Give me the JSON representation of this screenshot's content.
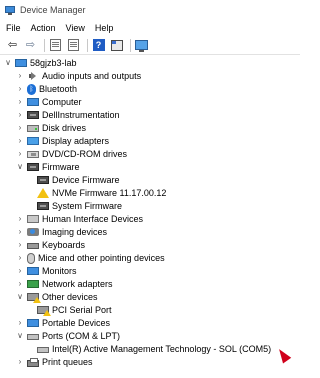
{
  "window": {
    "title": "Device Manager",
    "app_icon": "device-manager-icon"
  },
  "menu": [
    "File",
    "Action",
    "View",
    "Help"
  ],
  "toolbar": {
    "buttons": [
      "back-arrow-icon",
      "forward-arrow-icon",
      "show-hide-console-tree-icon",
      "properties-sheet-icon",
      "help-icon",
      "update-driver-icon",
      "scan-hardware-changes-icon"
    ]
  },
  "tree": {
    "root": "58gjzb3-lab",
    "items": [
      {
        "label": "Audio inputs and outputs",
        "icon": "speaker-icon",
        "expanded": false
      },
      {
        "label": "Bluetooth",
        "icon": "bluetooth-icon",
        "expanded": false
      },
      {
        "label": "Computer",
        "icon": "computer-icon",
        "expanded": false
      },
      {
        "label": "DellInstrumentation",
        "icon": "chip-icon",
        "expanded": false
      },
      {
        "label": "Disk drives",
        "icon": "disk-drive-icon",
        "expanded": false
      },
      {
        "label": "Display adapters",
        "icon": "display-adapter-icon",
        "expanded": false
      },
      {
        "label": "DVD/CD-ROM drives",
        "icon": "dvd-drive-icon",
        "expanded": false
      },
      {
        "label": "Firmware",
        "icon": "chip-icon",
        "expanded": true,
        "children": [
          {
            "label": "Device Firmware",
            "icon": "chip-icon"
          },
          {
            "label": "NVMe Firmware 11.17.00.12",
            "icon": "warning-icon"
          },
          {
            "label": "System Firmware",
            "icon": "chip-icon"
          }
        ]
      },
      {
        "label": "Human Interface Devices",
        "icon": "hid-icon",
        "expanded": false
      },
      {
        "label": "Imaging devices",
        "icon": "camera-icon",
        "expanded": false
      },
      {
        "label": "Keyboards",
        "icon": "keyboard-icon",
        "expanded": false
      },
      {
        "label": "Mice and other pointing devices",
        "icon": "mouse-icon",
        "expanded": false
      },
      {
        "label": "Monitors",
        "icon": "monitor-icon",
        "expanded": false
      },
      {
        "label": "Network adapters",
        "icon": "network-icon",
        "expanded": false
      },
      {
        "label": "Other devices",
        "icon": "other-device-icon",
        "expanded": true,
        "children": [
          {
            "label": "PCI Serial Port",
            "icon": "other-device-icon"
          }
        ]
      },
      {
        "label": "Portable Devices",
        "icon": "monitor-icon",
        "expanded": false
      },
      {
        "label": "Ports (COM & LPT)",
        "icon": "port-icon",
        "expanded": true,
        "children": [
          {
            "label": "Intel(R) Active Management Technology - SOL (COM5)",
            "icon": "port-icon"
          }
        ]
      },
      {
        "label": "Print queues",
        "icon": "printer-icon",
        "expanded": false
      }
    ]
  }
}
